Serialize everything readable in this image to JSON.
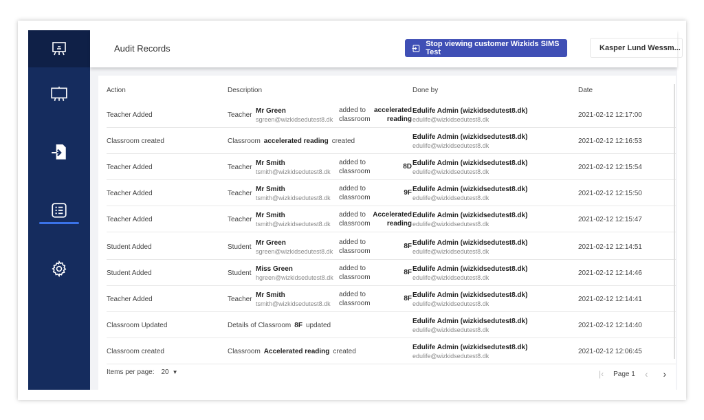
{
  "header": {
    "title": "Audit Records",
    "stop_button": "Stop viewing customer Wizkids SIMS Test",
    "user": "Kasper Lund Wessm..."
  },
  "sidebar": {
    "items": [
      "presentation-board",
      "whiteboard",
      "file-import",
      "audit-list",
      "settings"
    ],
    "active": "audit-list"
  },
  "table": {
    "columns": [
      "Action",
      "Description",
      "Done by",
      "Date"
    ],
    "rows": [
      {
        "action": "Teacher Added",
        "type": "Teacher",
        "name": "Mr Green",
        "email": "sgreen@wizkidsedutest8.dk",
        "verb1": "added to",
        "verb2": "classroom",
        "target1": "accelerated",
        "target2": "reading",
        "by": "Edulife Admin (wizkidsedutest8.dk)",
        "by_email": "edulife@wizkidsedutest8.dk",
        "date": "2021-02-12 12:17:00"
      },
      {
        "action": "Classroom created",
        "simple": [
          "Classroom",
          "accelerated reading",
          "created"
        ],
        "by": "Edulife Admin (wizkidsedutest8.dk)",
        "by_email": "edulife@wizkidsedutest8.dk",
        "date": "2021-02-12 12:16:53"
      },
      {
        "action": "Teacher Added",
        "type": "Teacher",
        "name": "Mr Smith",
        "email": "tsmith@wizkidsedutest8.dk",
        "verb1": "added to",
        "verb2": "classroom",
        "target1": "8D",
        "target2": "",
        "by": "Edulife Admin (wizkidsedutest8.dk)",
        "by_email": "edulife@wizkidsedutest8.dk",
        "date": "2021-02-12 12:15:54"
      },
      {
        "action": "Teacher Added",
        "type": "Teacher",
        "name": "Mr Smith",
        "email": "tsmith@wizkidsedutest8.dk",
        "verb1": "added to",
        "verb2": "classroom",
        "target1": "9F",
        "target2": "",
        "by": "Edulife Admin (wizkidsedutest8.dk)",
        "by_email": "edulife@wizkidsedutest8.dk",
        "date": "2021-02-12 12:15:50"
      },
      {
        "action": "Teacher Added",
        "type": "Teacher",
        "name": "Mr Smith",
        "email": "tsmith@wizkidsedutest8.dk",
        "verb1": "added to",
        "verb2": "classroom",
        "target1": "Accelerated",
        "target2": "reading",
        "by": "Edulife Admin (wizkidsedutest8.dk)",
        "by_email": "edulife@wizkidsedutest8.dk",
        "date": "2021-02-12 12:15:47"
      },
      {
        "action": "Student Added",
        "type": "Student",
        "name": "Mr Green",
        "email": "sgreen@wizkidsedutest8.dk",
        "verb1": "added to",
        "verb2": "classroom",
        "target1": "8F",
        "target2": "",
        "by": "Edulife Admin (wizkidsedutest8.dk)",
        "by_email": "edulife@wizkidsedutest8.dk",
        "date": "2021-02-12 12:14:51"
      },
      {
        "action": "Student Added",
        "type": "Student",
        "name": "Miss Green",
        "email": "hgreen@wizkidsedutest8.dk",
        "verb1": "added to",
        "verb2": "classroom",
        "target1": "8F",
        "target2": "",
        "by": "Edulife Admin (wizkidsedutest8.dk)",
        "by_email": "edulife@wizkidsedutest8.dk",
        "date": "2021-02-12 12:14:46"
      },
      {
        "action": "Teacher Added",
        "type": "Teacher",
        "name": "Mr Smith",
        "email": "tsmith@wizkidsedutest8.dk",
        "verb1": "added to",
        "verb2": "classroom",
        "target1": "8F",
        "target2": "",
        "by": "Edulife Admin (wizkidsedutest8.dk)",
        "by_email": "edulife@wizkidsedutest8.dk",
        "date": "2021-02-12 12:14:41"
      },
      {
        "action": "Classroom Updated",
        "simple": [
          "Details of Classroom",
          "8F",
          "updated"
        ],
        "by": "Edulife Admin (wizkidsedutest8.dk)",
        "by_email": "edulife@wizkidsedutest8.dk",
        "date": "2021-02-12 12:14:40"
      },
      {
        "action": "Classroom created",
        "simple": [
          "Classroom",
          "Accelerated reading",
          "created"
        ],
        "by": "Edulife Admin (wizkidsedutest8.dk)",
        "by_email": "edulife@wizkidsedutest8.dk",
        "date": "2021-02-12 12:06:45"
      }
    ]
  },
  "footer": {
    "items_per_page_label": "Items per page:",
    "items_per_page": "20",
    "page": "Page 1"
  }
}
